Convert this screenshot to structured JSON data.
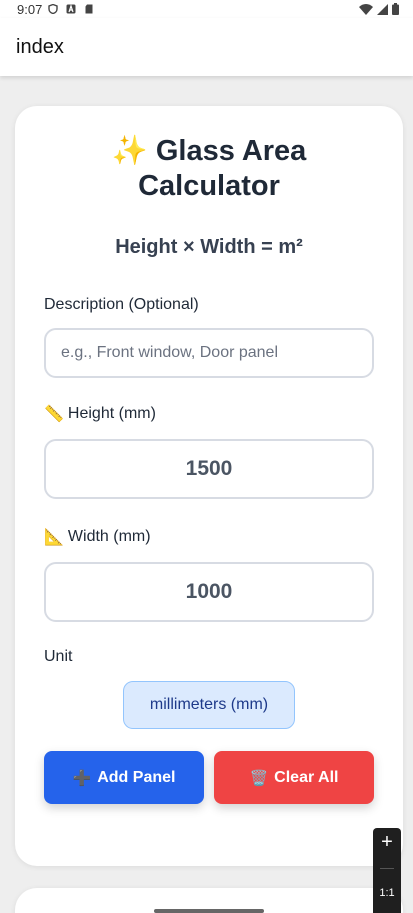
{
  "status_bar": {
    "time": "9:07",
    "left_icons": [
      "shield-icon",
      "a-icon",
      "sd-card-icon"
    ],
    "right_icons": [
      "wifi-icon",
      "signal-icon",
      "battery-icon"
    ]
  },
  "app_bar": {
    "title": "index"
  },
  "calculator": {
    "title_emoji": "✨",
    "title": "Glass Area Calculator",
    "formula": "Height × Width = m²",
    "description": {
      "label": "Description (Optional)",
      "value": "",
      "placeholder": "e.g., Front window, Door panel"
    },
    "height": {
      "icon": "📏",
      "label": "Height (mm)",
      "value": "1500"
    },
    "width": {
      "icon": "📐",
      "label": "Width (mm)",
      "value": "1000"
    },
    "unit": {
      "label": "Unit",
      "selected": "millimeters (mm)"
    },
    "add_button": {
      "icon": "➕",
      "label": "Add Panel"
    },
    "clear_button": {
      "icon": "🗑️",
      "label": "Clear All"
    }
  },
  "zoom_control": {
    "plus": "+",
    "ratio": "1:1"
  },
  "colors": {
    "primary": "#2563eb",
    "danger": "#ef4444",
    "unit_bg": "#dbeafe",
    "unit_border": "#93c5fd"
  }
}
